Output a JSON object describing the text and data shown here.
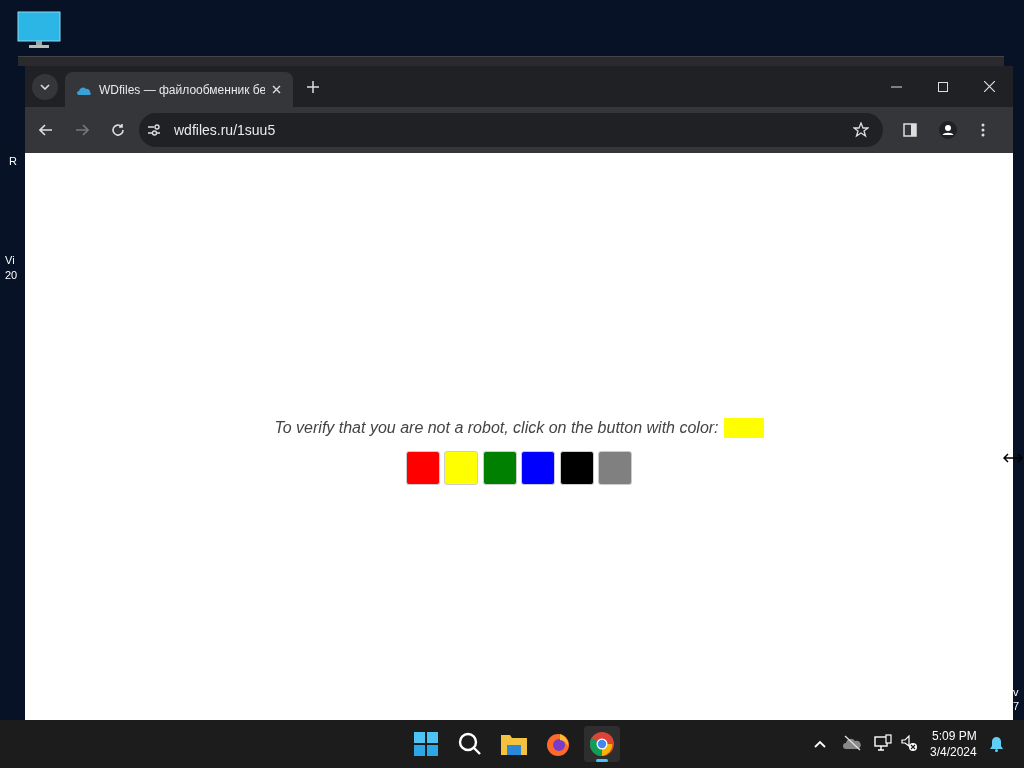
{
  "desktop": {
    "left_edge_texts": [
      "R",
      "Vi",
      "20"
    ],
    "right_edge_texts": [
      "v",
      "7"
    ]
  },
  "browser": {
    "tabs": [
      {
        "title": "WDfiles — файлообменник бе",
        "selected": true
      }
    ],
    "address": "wdfiles.ru/1suu5"
  },
  "page": {
    "prompt": "To verify that you are not a robot, click on the button with color:",
    "target_swatch": {
      "color": "#ffff00"
    },
    "color_buttons": [
      {
        "color": "#ff0000"
      },
      {
        "color": "#ffff00"
      },
      {
        "color": "#008000"
      },
      {
        "color": "#0000ff"
      },
      {
        "color": "#000000"
      },
      {
        "color": "#808080"
      }
    ]
  },
  "taskbar": {
    "apps": [
      {
        "kind": "start",
        "selected": false
      },
      {
        "kind": "search",
        "selected": false
      },
      {
        "kind": "files",
        "selected": false
      },
      {
        "kind": "firefox",
        "selected": false
      },
      {
        "kind": "chrome",
        "selected": true
      }
    ],
    "time": "5:09 PM",
    "date": "3/4/2024"
  }
}
